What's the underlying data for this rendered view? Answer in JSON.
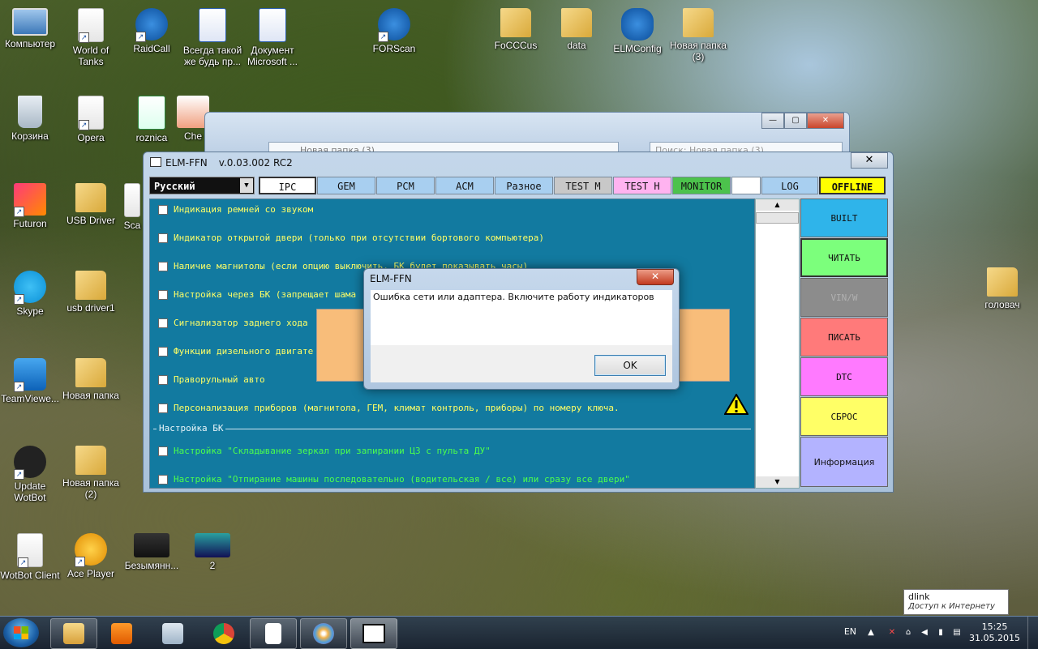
{
  "desktop": {
    "icons": [
      {
        "label": "Компьютер"
      },
      {
        "label": "World of Tanks"
      },
      {
        "label": "RaidCall"
      },
      {
        "label": "Всегда такой же будь пр..."
      },
      {
        "label": "Документ Microsoft ..."
      },
      {
        "label": "FORScan"
      },
      {
        "label": "FoCCCus"
      },
      {
        "label": "data"
      },
      {
        "label": "ELMConfig"
      },
      {
        "label": "Новая папка (3)"
      },
      {
        "label": "Корзина"
      },
      {
        "label": "Opera"
      },
      {
        "label": "roznica"
      },
      {
        "label": "Che"
      },
      {
        "label": "Futuron"
      },
      {
        "label": "USB Driver"
      },
      {
        "label": "Sca"
      },
      {
        "label": "Skype"
      },
      {
        "label": "usb driver1"
      },
      {
        "label": "TeamViewe..."
      },
      {
        "label": "Новая папка"
      },
      {
        "label": "Update WotBot"
      },
      {
        "label": "Новая папка (2)"
      },
      {
        "label": "WotBot Client"
      },
      {
        "label": "Ace Player"
      },
      {
        "label": "Безымянн..."
      },
      {
        "label": "2"
      },
      {
        "label": "головач"
      }
    ]
  },
  "explorer": {
    "address": "Новая папка (3)",
    "search_placeholder": "Поиск: Новая папка (3)"
  },
  "elm": {
    "title": "ELM-FFN",
    "version": "v.0.03.002 RC2",
    "language": "Русский",
    "tabs": [
      {
        "label": "IPC",
        "color": "#ffffff"
      },
      {
        "label": "GEM",
        "color": "#a8cff0"
      },
      {
        "label": "PCM",
        "color": "#a8cff0"
      },
      {
        "label": "ACM",
        "color": "#a8cff0"
      },
      {
        "label": "Разное",
        "color": "#a8cff0"
      },
      {
        "label": "TEST M",
        "color": "#c8c8c8"
      },
      {
        "label": "TEST H",
        "color": "#ffb3f0"
      },
      {
        "label": "MONITOR",
        "color": "#4cc24c"
      },
      {
        "label": "",
        "color": "#ffffff"
      },
      {
        "label": "LOG",
        "color": "#a8cff0"
      },
      {
        "label": "OFFLINE",
        "color": "#ffff00"
      }
    ],
    "options": [
      "Индикация ремней со звуком",
      "Индикатор открытой двери (только при отсутствии бортового компьютера)",
      "Наличие магнитолы (если опцию выключить, БК будет показывать часы)",
      "Настройка через БК (запрещает шама",
      "Сигнализатор заднего хода",
      "Функции дизельного двигате",
      "Праворульный авто",
      "Персонализация приборов (магнитола, ГЕМ, климат контроль, приборы) по номеру ключа."
    ],
    "group_label": "Настройка БК",
    "group_options": [
      "Настройка \"Складывание зеркал при запирании ЦЗ с пульта ДУ\"",
      "Настройка \"Отпирание машины последовательно (водительская / все) или сразу все двери\""
    ],
    "side_buttons": [
      {
        "label": "BUILT",
        "color": "#2fb4ea"
      },
      {
        "label": "ЧИТАТЬ",
        "color": "#7cff7c"
      },
      {
        "label": "VIN/W",
        "color": "#8c8c8c"
      },
      {
        "label": "ПИСАТЬ",
        "color": "#ff7a7a"
      },
      {
        "label": "DTC",
        "color": "#ff7aff"
      },
      {
        "label": "СБРОС",
        "color": "#ffff66"
      },
      {
        "label": "Информация",
        "color": "#b3b3ff"
      }
    ]
  },
  "dialog": {
    "title": "ELM-FFN",
    "message": "Ошибка сети или адаптера. Включите работу индикаторов",
    "ok_label": "OK"
  },
  "tooltip": {
    "title": "dlink",
    "status": "Доступ к Интернету"
  },
  "taskbar": {
    "language": "EN",
    "time": "15:25",
    "date": "31.05.2015"
  }
}
